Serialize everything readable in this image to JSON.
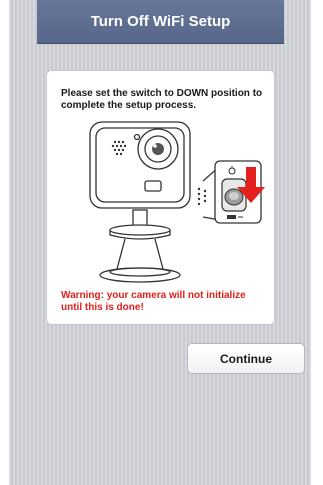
{
  "header": {
    "title": "Turn Off WiFi Setup"
  },
  "card": {
    "instruction": "Please set the switch to DOWN position to complete the setup process.",
    "illustration_icon": "camera-switch-illustration",
    "arrow_icon": "down-arrow-icon",
    "warning": "Warning: your camera will not initialize until this is done!"
  },
  "actions": {
    "continue_label": "Continue"
  },
  "colors": {
    "header_bg": "#5f7093",
    "warning_text": "#e0201b",
    "arrow_red": "#e3201c",
    "background_stripes": "#d3d4d9"
  }
}
